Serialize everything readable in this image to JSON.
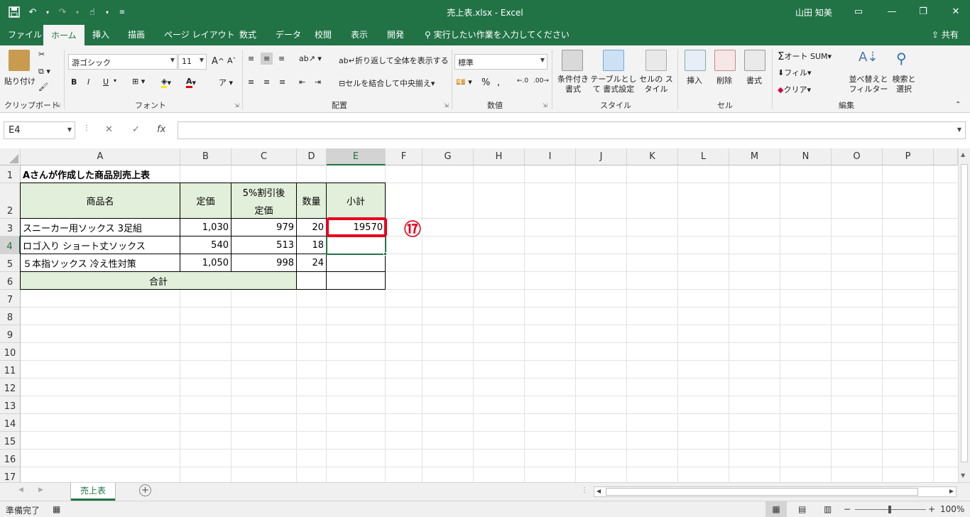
{
  "window": {
    "title": "売上表.xlsx  -  Excel",
    "user": "山田 知美"
  },
  "ribbon_tabs": [
    "ファイル",
    "ホーム",
    "挿入",
    "描画",
    "ページ レイアウト",
    "数式",
    "データ",
    "校閲",
    "表示",
    "開発"
  ],
  "tell_me": "実行したい作業を入力してください",
  "share": "共有",
  "ribbon": {
    "clipboard": {
      "paste": "貼り付け",
      "label": "クリップボード"
    },
    "font": {
      "name": "游ゴシック",
      "size": "11",
      "label": "フォント",
      "bold": "B",
      "italic": "I",
      "underline": "U"
    },
    "alignment": {
      "wrap": "折り返して全体を表示する",
      "merge": "セルを結合して中央揃え",
      "label": "配置"
    },
    "number": {
      "format": "標準",
      "label": "数値"
    },
    "styles": {
      "conditional": "条件付き 書式",
      "table": "テーブルとして 書式設定",
      "cell": "セルの スタイル",
      "label": "スタイル"
    },
    "cells": {
      "insert": "挿入",
      "delete": "削除",
      "format": "書式",
      "label": "セル"
    },
    "editing": {
      "autosum": "オート SUM",
      "fill": "フィル",
      "clear": "クリア",
      "sort": "並べ替えと フィルター",
      "find": "検索と 選択",
      "label": "編集"
    }
  },
  "formula_bar": {
    "name_box": "E4",
    "fx": "fx",
    "formula": ""
  },
  "columns": [
    "A",
    "B",
    "C",
    "D",
    "E",
    "F",
    "G",
    "H",
    "I",
    "J",
    "K",
    "L",
    "M",
    "N",
    "O",
    "P"
  ],
  "rows": [
    "1",
    "2",
    "3",
    "4",
    "5",
    "6",
    "7",
    "8",
    "9",
    "10",
    "11",
    "12",
    "13",
    "14",
    "15",
    "16",
    "17"
  ],
  "sheet": {
    "title": "Aさんが作成した商品別売上表",
    "headers": {
      "a": "商品名",
      "b": "定価",
      "c1": "5%割引後",
      "c2": "定価",
      "d": "数量",
      "e": "小計"
    },
    "rows": [
      {
        "name": "スニーカー用ソックス 3足組",
        "price": "1,030",
        "discount": "979",
        "qty": "20",
        "subtotal": "19570"
      },
      {
        "name": "ロゴ入り ショート丈ソックス",
        "price": "540",
        "discount": "513",
        "qty": "18",
        "subtotal": ""
      },
      {
        "name": "５本指ソックス 冷え性対策",
        "price": "1,050",
        "discount": "998",
        "qty": "24",
        "subtotal": ""
      }
    ],
    "total_label": "合計"
  },
  "annotation": {
    "step": "⑰",
    "color": "#e8001c"
  },
  "sheet_tabs": [
    "売上表"
  ],
  "status": {
    "ready": "準備完了",
    "zoom": "100%"
  },
  "colors": {
    "accent": "#217346",
    "header_fill": "#e2efda"
  }
}
